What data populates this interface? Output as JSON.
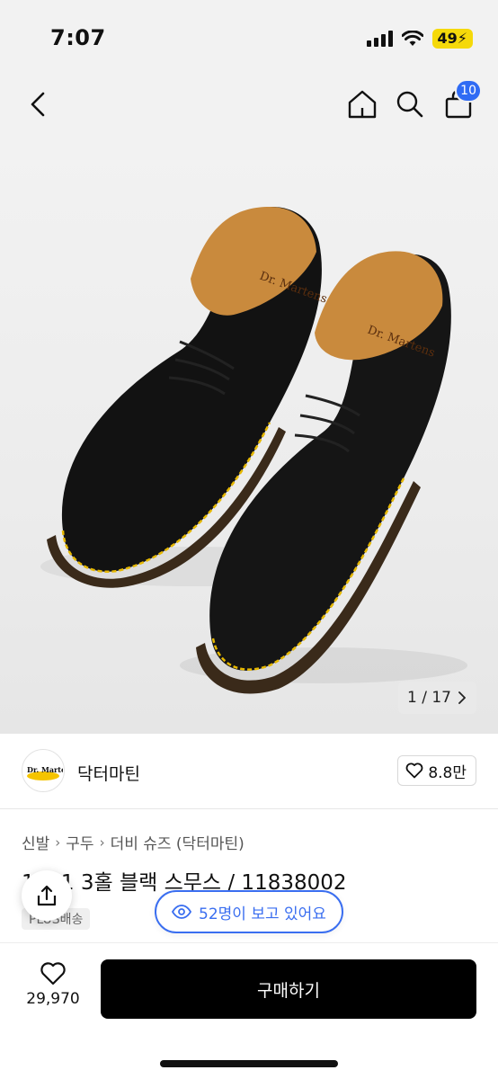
{
  "status_bar": {
    "time": "7:07",
    "battery": "49"
  },
  "nav": {
    "cart_count": "10"
  },
  "gallery": {
    "counter": "1 / 17"
  },
  "brand": {
    "logo_text": "Dr. Martens",
    "name": "닥터마틴",
    "likes": "8.8만"
  },
  "breadcrumb": [
    "신발",
    "구두",
    "더비 슈즈 (닥터마틴)"
  ],
  "product": {
    "title": "1461 3홀 블랙 스무스 / 11838002",
    "delivery_tag": "PLUS배송"
  },
  "viewers": {
    "label": "52명이 보고 있어요"
  },
  "bottom": {
    "wish_count": "29,970",
    "buy_label": "구매하기"
  },
  "colors": {
    "accent": "#3a6ef0",
    "badge": "#2f6bf4",
    "buy_bg": "#000000",
    "stitch": "#e6b800"
  }
}
